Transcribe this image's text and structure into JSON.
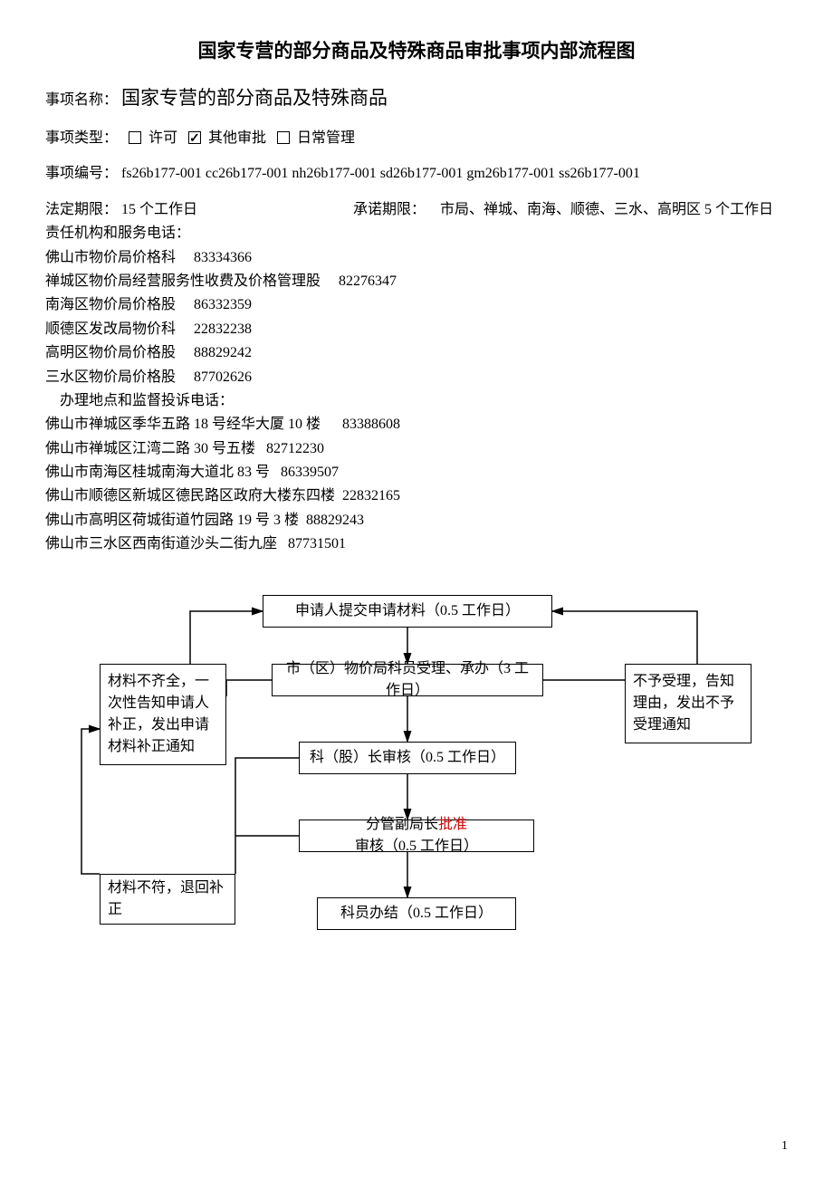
{
  "title": "国家专营的部分商品及特殊商品审批事项内部流程图",
  "matter": {
    "name_label": "事项名称：",
    "name_value": "国家专营的部分商品及特殊商品",
    "type_label": "事项类型：",
    "type_opts": {
      "permit": "许可",
      "other": "其他审批",
      "daily": "日常管理"
    },
    "code_label": "事项编号：",
    "code_value": "fs26b177-001 cc26b177-001 nh26b177-001 sd26b177-001 gm26b177-001 ss26b177-001"
  },
  "deadlines": {
    "legal_label": "法定期限：",
    "legal_value": "15 个工作日",
    "promise_label": "承诺期限：",
    "promise_value": "市局、禅城、南海、顺德、三水、高明区 5 个工作日"
  },
  "responsibility": {
    "header": "责任机构和服务电话：",
    "lines": [
      "佛山市物价局价格科     83334366",
      "禅城区物价局经营服务性收费及价格管理股     82276347",
      "南海区物价局价格股     86332359",
      "顺德区发改局物价科     22832238",
      "高明区物价局价格股     88829242",
      "三水区物价局价格股     87702626"
    ]
  },
  "locations": {
    "header": "办理地点和监督投诉电话：",
    "lines": [
      "佛山市禅城区季华五路 18 号经华大厦 10 楼      83388608",
      "佛山市禅城区江湾二路 30 号五楼   82712230",
      "佛山市南海区桂城南海大道北 83 号   86339507",
      "佛山市顺德区新城区德民路区政府大楼东四楼  22832165",
      "佛山市高明区荷城街道竹园路 19 号 3 楼  88829243",
      "佛山市三水区西南街道沙头二街九座   87731501"
    ]
  },
  "flow": {
    "submit": "申请人提交申请材料（0.5 工作日）",
    "accept": "市（区）物价局科员受理、承办（3 工作日）",
    "section_review": "科（股）长审核（0.5 工作日）",
    "deputy_prefix": "分管副局长",
    "deputy_highlight": "批准",
    "deputy_suffix": "审核（0.5 工作日）",
    "conclude": "科员办结（0.5 工作日）",
    "incomplete": "材料不齐全，一次性告知申请人补正，发出申请材料补正通知",
    "reject": "不予受理，告知理由，发出不予受理通知",
    "return": "材料不符，退回补正"
  },
  "page_number": "1"
}
